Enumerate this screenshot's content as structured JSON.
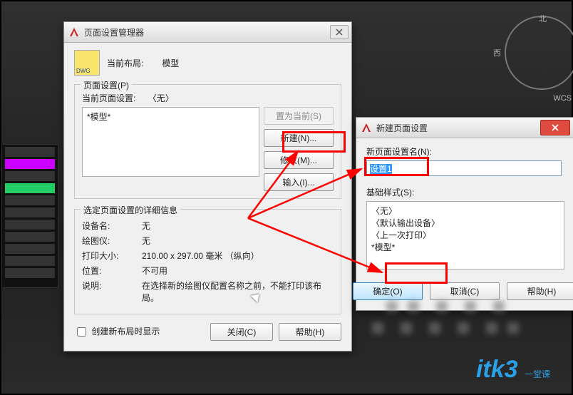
{
  "compass": {
    "north": "北",
    "west": "西"
  },
  "wcs_text": "WCS",
  "dialog1": {
    "title": "页面设置管理器",
    "current_layout_label": "当前布局:",
    "current_layout_value": "模型",
    "page_setup_group": "页面设置(P)",
    "current_page_setup_label": "当前页面设置:",
    "current_page_setup_value": "〈无〉",
    "list_item": "*模型*",
    "btn_set_current": "置为当前(S)",
    "btn_new": "新建(N)...",
    "btn_modify": "修改(M)...",
    "btn_import": "输入(I)...",
    "details_group": "选定页面设置的详细信息",
    "details": {
      "device_label": "设备名:",
      "device_value": "无",
      "plotter_label": "绘图仪:",
      "plotter_value": "无",
      "size_label": "打印大小:",
      "size_value": "210.00 x 297.00 毫米  （纵向）",
      "pos_label": "位置:",
      "pos_value": "不可用",
      "note_label": "说明:",
      "note_value": "在选择新的绘图仪配置名称之前，不能打印该布局。"
    },
    "chk_label": "创建新布局时显示",
    "btn_close": "关闭(C)",
    "btn_help": "帮助(H)"
  },
  "dialog2": {
    "title": "新建页面设置",
    "name_label": "新页面设置名(N):",
    "name_value": "设置1",
    "base_group": "基础样式(S):",
    "base_list": [
      "〈无〉",
      "〈默认输出设备〉",
      "〈上一次打印〉",
      "*模型*"
    ],
    "btn_ok": "确定(O)",
    "btn_cancel": "取消(C)",
    "btn_help": "帮助(H)"
  },
  "logo_text": "itk3",
  "logo_sub": "一堂课"
}
